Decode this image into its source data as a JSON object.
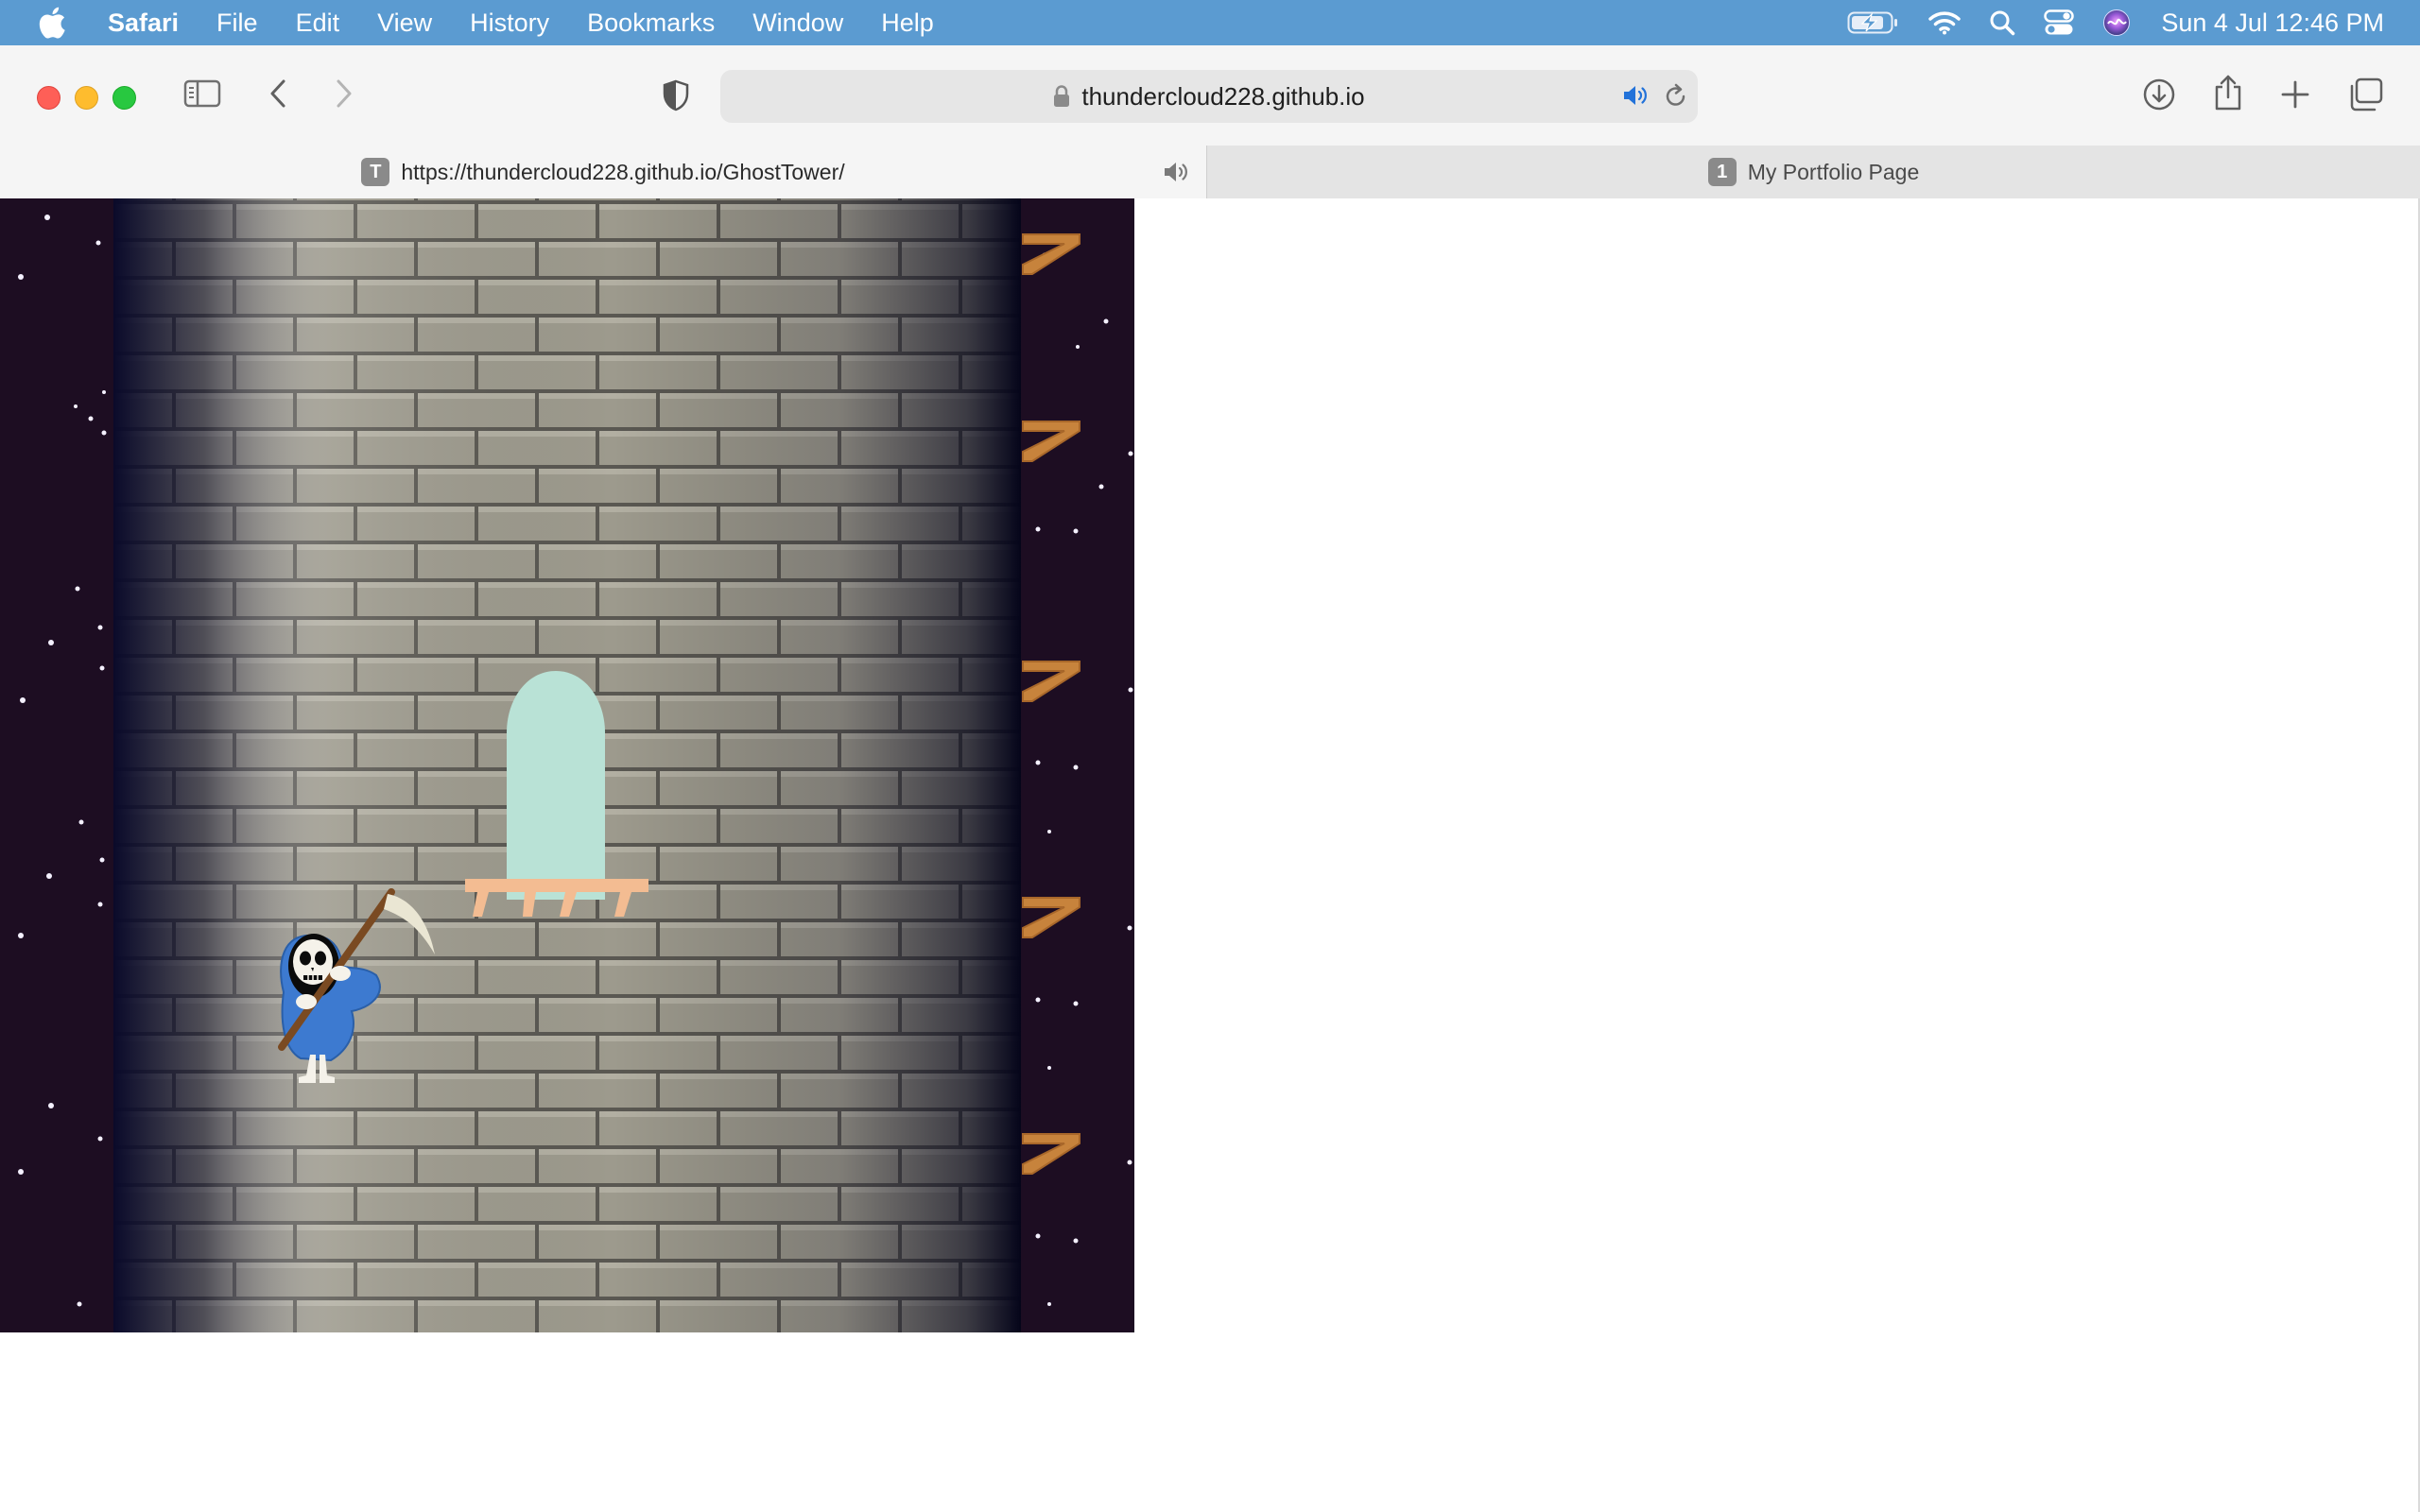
{
  "menubar": {
    "app_name": "Safari",
    "menus": [
      "File",
      "Edit",
      "View",
      "History",
      "Bookmarks",
      "Window",
      "Help"
    ],
    "clock": "Sun 4 Jul  12:46 PM",
    "status_icons": [
      "battery-charging-icon",
      "wifi-icon",
      "spotlight-search-icon",
      "control-center-icon",
      "siri-icon"
    ]
  },
  "toolbar": {
    "address": "thundercloud228.github.io",
    "icons": [
      "sidebar-icon",
      "back-icon",
      "forward-icon",
      "privacy-shield-icon",
      "downloads-icon",
      "share-icon",
      "new-tab-icon",
      "tab-overview-icon"
    ]
  },
  "tabs": [
    {
      "favicon": "T",
      "label": "https://thundercloud228.github.io/GhostTower/",
      "active": true,
      "audio": true
    },
    {
      "favicon": "1",
      "label": "My Portfolio Page",
      "active": false
    }
  ],
  "game": {
    "title": "GhostTower",
    "character": "grim-reaper",
    "colors": {
      "night_sky": "#1d0d22",
      "brick": "#9d9a8d",
      "mortar": "#5a5852",
      "window": "#b9e2d6",
      "ledge": "#f3bc92",
      "peg": "#c7833c",
      "robe": "#3d7ad0"
    }
  }
}
